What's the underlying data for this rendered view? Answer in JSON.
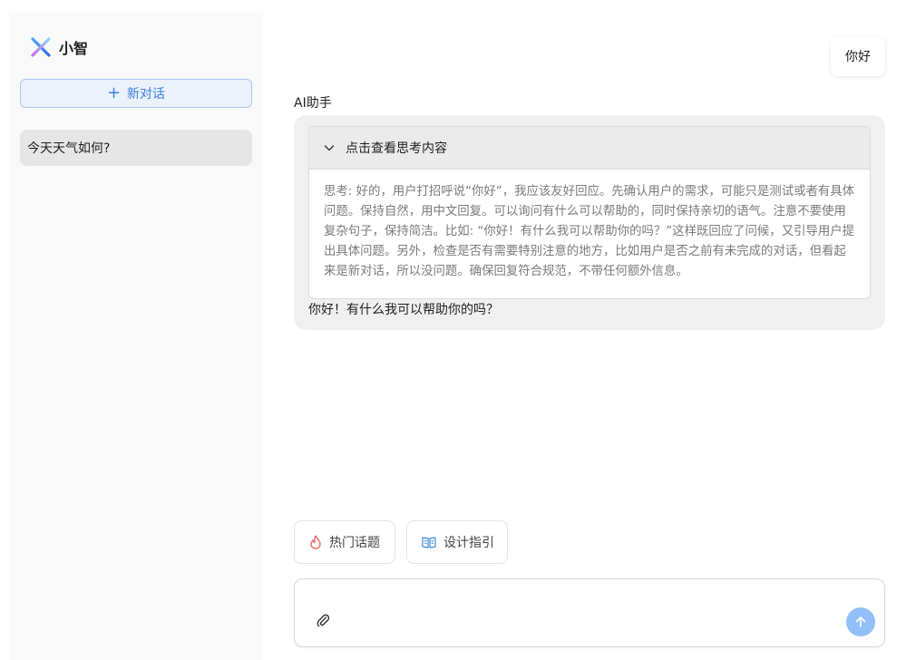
{
  "sidebar": {
    "brand_name": "小智",
    "new_chat_label": "新对话",
    "conversations": [
      {
        "title": "今天天气如何?"
      }
    ]
  },
  "chat": {
    "user_message": "你好",
    "ai_name": "AI助手",
    "thinking_toggle_label": "点击查看思考内容",
    "thinking_content": "思考: 好的，用户打招呼说“你好”，我应该友好回应。先确认用户的需求，可能只是测试或者有具体问题。保持自然，用中文回复。可以询问有什么可以帮助的，同时保持亲切的语气。注意不要使用复杂句子，保持简洁。比如: “你好！有什么我可以帮助你的吗？”这样既回应了问候，又引导用户提出具体问题。另外，检查是否有需要特别注意的地方，比如用户是否之前有未完成的对话，但看起来是新对话，所以没问题。确保回复符合规范，不带任何额外信息。",
    "ai_answer": "你好！有什么我可以帮助你的吗？"
  },
  "prompts": {
    "hot_topics_label": "热门话题",
    "design_guide_label": "设计指引"
  },
  "composer": {
    "value": "",
    "placeholder": ""
  },
  "colors": {
    "accent": "#3d7ee6",
    "send_button": "#91c0fa",
    "hot_icon": "#f25c5c",
    "design_icon": "#3d8bd9"
  },
  "icons": {
    "brand": "x-logo-icon",
    "new_chat": "plus-icon",
    "toggle": "chevron-down-icon",
    "hot": "fire-icon",
    "design": "book-icon",
    "attach": "paperclip-icon",
    "send": "arrow-up-icon"
  }
}
